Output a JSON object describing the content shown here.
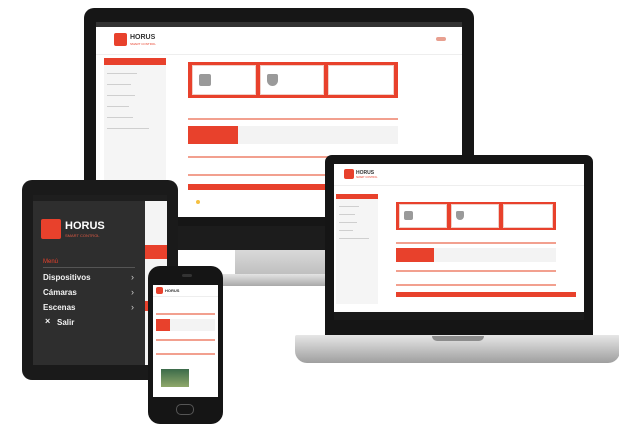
{
  "brand": {
    "name": "HORUS",
    "tagline": "SMART CONTROL",
    "accent_color": "#e8412c"
  },
  "tablet_menu": {
    "title": "Menú",
    "items": [
      {
        "label": "Dispositivos",
        "icon": "chevron-right-icon"
      },
      {
        "label": "Cámaras",
        "icon": "chevron-right-icon"
      },
      {
        "label": "Escenas",
        "icon": "chevron-right-icon"
      }
    ],
    "logout_label": "Salir",
    "logout_icon": "close-icon"
  },
  "tabs": [
    {
      "icon": "home-icon"
    },
    {
      "icon": "wifi-icon"
    },
    {
      "icon": "moon-icon"
    },
    {
      "icon": "tools-icon"
    }
  ]
}
